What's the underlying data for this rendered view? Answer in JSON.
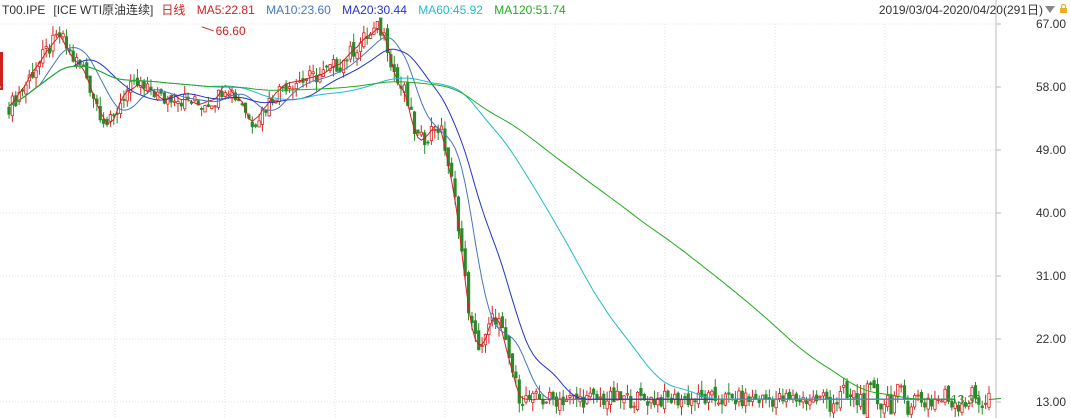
{
  "header": {
    "symbol": "T00.IPE",
    "instrument": "[ICE WTI原油连续]",
    "period": "日线",
    "range": "2019/03/04-2020/04/20(291日)"
  },
  "legend": [
    {
      "label": "MA5:22.81",
      "color": "#cc2222"
    },
    {
      "label": "MA10:23.60",
      "color": "#4477bb"
    },
    {
      "label": "MA20:30.44",
      "color": "#2233cc"
    },
    {
      "label": "MA60:45.92",
      "color": "#22bbcc"
    },
    {
      "label": "MA120:51.74",
      "color": "#22aa22"
    }
  ],
  "colors": {
    "up": "#d62424",
    "down": "#2a8a2a",
    "grid": "#e2e2e2",
    "axis": "#bbbbbb"
  },
  "icons": {
    "dropdown": "triangle-down-icon",
    "lock": "lock-icon"
  },
  "chart_data": {
    "type": "candlestick",
    "ylim": [
      13,
      67
    ],
    "yticks": [
      "67.00",
      "58.00",
      "49.00",
      "40.00",
      "31.00",
      "22.00",
      "13.00"
    ],
    "grid": true,
    "annotations": [
      {
        "text": "66.60",
        "index": 57,
        "value": 66.6,
        "color": "#cc2222"
      },
      {
        "text": "13.36",
        "index": 290,
        "value": 13.36,
        "color": "#2a8a2a"
      }
    ],
    "series": [
      {
        "name": "MA5",
        "color": "#cc2222",
        "values": [
          55.3,
          55.7,
          56.4,
          57.1,
          57.7,
          58.4,
          59.4,
          60.2,
          60.8,
          61.4,
          62.2,
          63.0,
          63.6,
          64.2,
          64.8,
          65.4,
          64.6,
          63.7,
          62.8,
          62.1,
          61.6,
          61.1,
          60.5,
          59.5,
          58.1,
          56.8,
          55.6,
          54.5,
          53.6,
          52.8,
          52.9,
          53.4,
          54.6,
          55.9,
          56.8,
          57.4,
          57.6,
          57.9,
          58.3,
          58.2,
          57.6,
          57.4,
          57.7,
          57.3,
          56.8,
          56.4,
          56.2,
          56.3,
          56.7,
          56.9,
          56.4,
          56.2,
          56.2,
          56.2,
          55.9,
          55.7,
          55.5,
          55.6,
          55.8,
          56.0,
          56.1,
          56.3,
          56.8,
          57.8,
          58.2,
          58.0,
          57.3,
          56.8,
          56.3,
          55.9,
          54.7,
          53.5,
          53.1,
          53.5,
          53.9,
          54.7,
          55.2,
          55.9,
          56.5,
          57.2,
          57.5,
          58.1,
          58.4,
          58.6,
          58.7,
          58.8,
          58.9,
          59.0,
          59.2,
          59.3,
          59.4,
          59.6,
          59.7,
          59.9,
          60.2,
          60.6,
          60.9,
          61.1,
          61.3,
          61.8,
          62.3,
          62.8,
          63.4,
          63.7,
          64.3,
          64.8,
          65.3,
          65.4,
          65.9,
          66.3,
          66.1,
          65.4,
          64.0,
          62.0,
          60.2,
          58.7,
          57.9,
          57.3,
          55.6,
          53.6,
          51.9,
          50.8,
          50.4,
          50.7,
          51.2,
          51.8,
          52.4,
          52.2,
          51.4,
          49.5,
          46.9,
          44.5,
          41.7,
          38.6,
          34.4,
          30.3,
          26.6,
          23.6,
          22.0,
          21.2,
          21.2,
          22.0,
          23.5,
          24.7,
          25.1,
          24.4,
          22.8,
          20.9,
          19.1,
          17.3,
          15.5,
          14.0,
          13.5,
          13.4,
          13.4,
          13.3,
          13.4,
          13.4,
          13.3,
          13.4,
          13.4,
          13.4,
          13.4,
          13.4,
          13.4,
          13.4,
          13.4,
          13.4,
          13.4,
          13.4,
          13.4,
          13.4,
          13.4,
          13.4,
          13.4,
          13.4,
          13.4,
          13.4,
          13.4,
          13.4,
          13.4,
          13.4,
          13.4,
          13.4,
          13.4,
          13.4,
          13.4,
          13.4,
          13.4,
          13.4,
          13.4,
          13.4,
          13.4,
          13.4,
          13.4,
          13.4,
          13.4,
          13.4,
          13.4,
          13.4,
          13.4,
          13.4,
          13.4,
          13.4,
          13.4,
          13.4,
          13.4,
          13.4,
          13.4,
          13.4,
          13.4,
          13.4,
          13.4,
          13.4,
          13.4,
          13.4,
          13.4,
          13.4,
          13.4,
          13.4,
          13.4,
          13.4,
          13.4,
          13.4,
          13.4,
          13.4,
          13.4,
          13.4,
          13.4,
          13.4,
          13.4,
          13.4,
          13.4,
          13.4,
          13.4,
          13.4,
          13.4,
          13.4,
          13.4,
          13.4,
          13.4,
          13.4,
          13.4,
          13.4,
          13.4,
          13.4,
          13.4,
          13.4,
          13.4,
          13.4,
          13.4,
          13.4,
          13.4,
          13.4,
          13.4,
          13.4,
          13.4,
          13.4,
          13.4,
          13.4,
          13.4,
          13.4,
          13.4,
          13.4,
          13.4,
          13.4,
          13.4,
          13.4,
          13.4,
          13.4,
          13.4,
          13.4,
          13.4,
          13.4,
          13.4,
          13.4,
          13.4,
          13.4,
          13.4,
          13.4,
          13.4
        ]
      },
      {
        "name": "MA10",
        "color": "#4477bb",
        "values": []
      },
      {
        "name": "MA20",
        "color": "#2233cc",
        "values": []
      },
      {
        "name": "MA60",
        "color": "#22bbcc",
        "values": []
      },
      {
        "name": "MA120",
        "color": "#22aa22",
        "values": []
      }
    ]
  }
}
